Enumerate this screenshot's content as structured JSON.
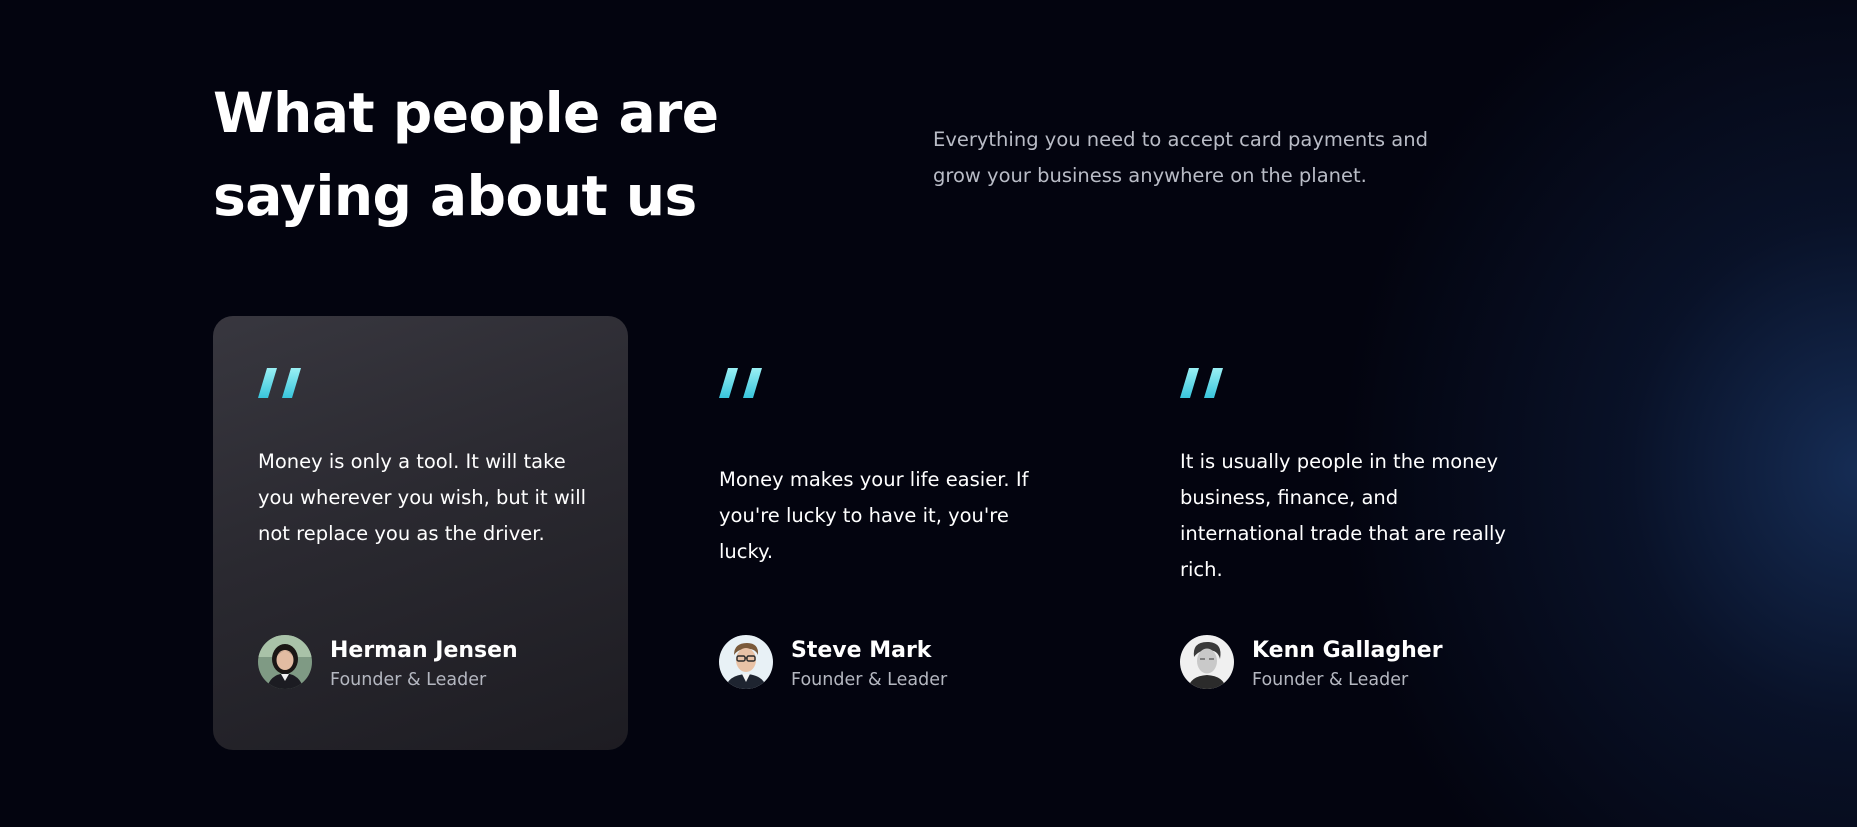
{
  "section": {
    "heading": "What people are saying about us",
    "lead": "Everything you need to accept card payments and grow your business anywhere on the planet."
  },
  "colors": {
    "background": "#03040f",
    "glow": "#1c3a6c",
    "featured_card": "#2e2d35",
    "quote_mark_top": "#9af0f4",
    "quote_mark_bottom": "#38c5dc",
    "muted_text": "#b4b7c0"
  },
  "testimonials": [
    {
      "quote_icon": "quote-icon",
      "text": "Money is only a tool. It will take you wherever you wish, but it will not replace you as the driver.",
      "name": "Herman Jensen",
      "role": "Founder & Leader",
      "avatar_icon": "avatar-photo",
      "featured": true
    },
    {
      "quote_icon": "quote-icon",
      "text": "Money makes your life easier. If you're lucky to have it, you're lucky.",
      "name": "Steve Mark",
      "role": "Founder & Leader",
      "avatar_icon": "avatar-photo",
      "featured": false
    },
    {
      "quote_icon": "quote-icon",
      "text": "It is usually people in the money business, finance, and international trade that are really rich.",
      "name": "Kenn Gallagher",
      "role": "Founder & Leader",
      "avatar_icon": "avatar-photo",
      "featured": false
    }
  ]
}
